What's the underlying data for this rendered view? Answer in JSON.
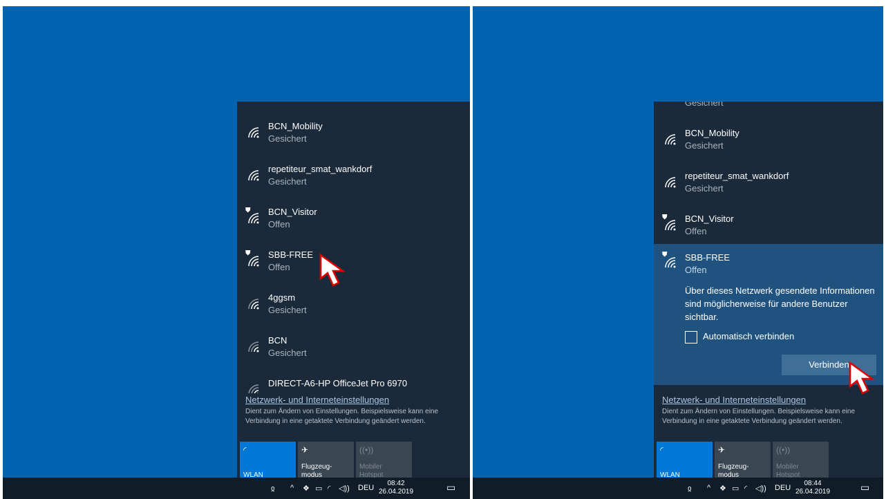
{
  "networks": [
    {
      "name": "BCN_Mobility",
      "status": "Gesichert",
      "secured": true
    },
    {
      "name": "repetiteur_smat_wankdorf",
      "status": "Gesichert",
      "secured": true
    },
    {
      "name": "BCN_Visitor",
      "status": "Offen",
      "secured": false
    },
    {
      "name": "SBB-FREE",
      "status": "Offen",
      "secured": false
    },
    {
      "name": "4ggsm",
      "status": "Gesichert",
      "secured": true
    },
    {
      "name": "BCN",
      "status": "Gesichert",
      "secured": true
    },
    {
      "name": "DIRECT-A6-HP OfficeJet Pro 6970",
      "status": "",
      "secured": true
    }
  ],
  "right_top_partial": "Gesichert",
  "expanded": {
    "name": "SBB-FREE",
    "status": "Offen",
    "warning": "Über dieses Netzwerk gesendete Informationen sind möglicherweise für andere Benutzer sichtbar.",
    "auto_connect_label": "Automatisch verbinden",
    "connect_button": "Verbinden"
  },
  "settings": {
    "link": "Netzwerk- und Interneteinstellungen",
    "description": "Dient zum Ändern von Einstellungen. Beispielsweise kann eine Verbindung in eine getaktete Verbindung geändert werden."
  },
  "quick_actions": [
    {
      "label": "WLAN",
      "icon": "wifi-icon",
      "active": true
    },
    {
      "label": "Flugzeug-\nmodus",
      "line1": "Flugzeug-",
      "line2": "modus",
      "icon": "airplane-icon",
      "active": false
    },
    {
      "label": "Mobiler\nHotspot",
      "line1": "Mobiler",
      "line2": "Hotspot",
      "icon": "hotspot-icon",
      "active": false,
      "disabled": true
    }
  ],
  "taskbar_left": {
    "lang": "DEU",
    "time": "08:42",
    "date": "26.04.2019"
  },
  "taskbar_right": {
    "lang": "DEU",
    "time": "08:44",
    "date": "26.04.2019"
  },
  "colors": {
    "desktop": "#0063b1",
    "flyout": "#1b2a3a",
    "expanded": "#20527f",
    "accent": "#0078d7",
    "taskbar": "#101c28"
  }
}
